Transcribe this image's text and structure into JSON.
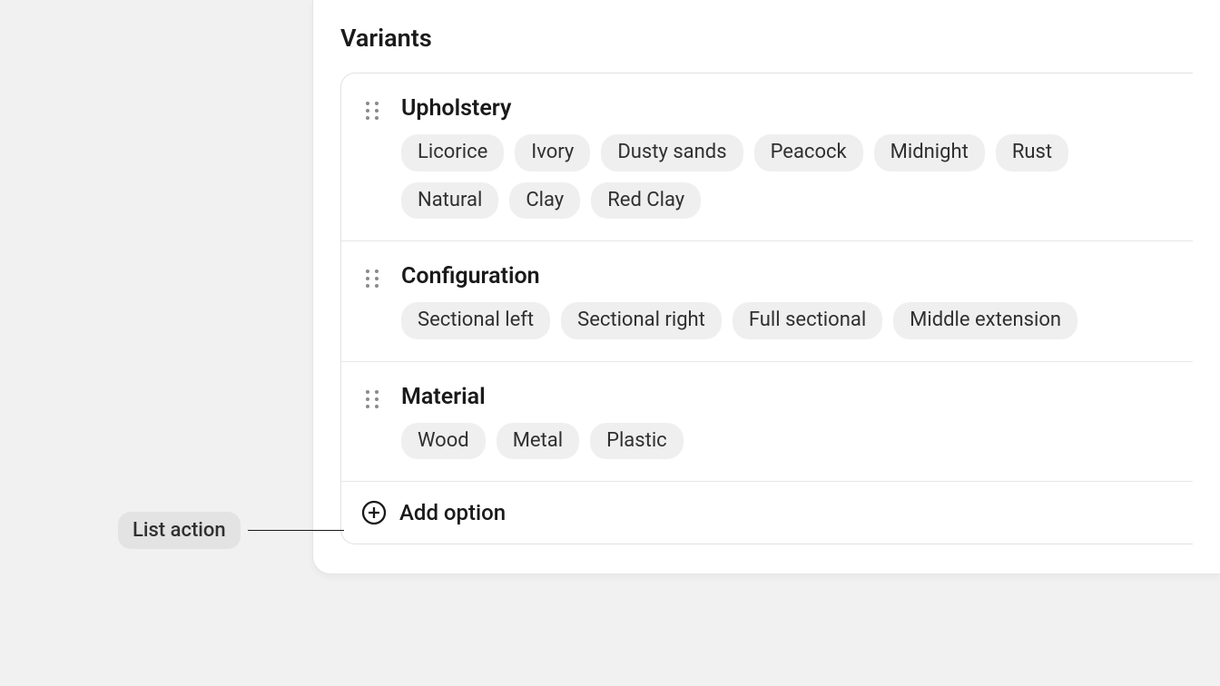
{
  "section_title": "Variants",
  "options": [
    {
      "name": "Upholstery",
      "values": [
        "Licorice",
        "Ivory",
        "Dusty sands",
        "Peacock",
        "Midnight",
        "Rust",
        "Natural",
        "Clay",
        "Red Clay"
      ]
    },
    {
      "name": "Configuration",
      "values": [
        "Sectional left",
        "Sectional right",
        "Full sectional",
        "Middle extension"
      ]
    },
    {
      "name": "Material",
      "values": [
        "Wood",
        "Metal",
        "Plastic"
      ]
    }
  ],
  "add_option_label": "Add option",
  "annotation_label": "List action"
}
